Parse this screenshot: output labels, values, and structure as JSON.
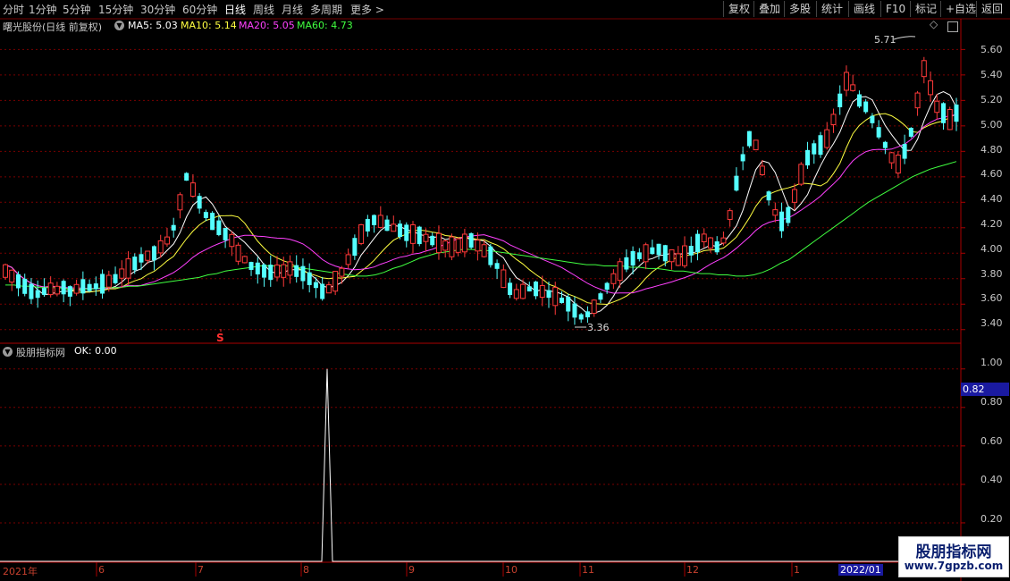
{
  "toolbar": {
    "tabs": [
      "分时",
      "1分钟",
      "5分钟",
      "15分钟",
      "30分钟",
      "60分钟",
      "日线",
      "周线",
      "月线",
      "多周期",
      "更多 >"
    ],
    "active_tab": "日线",
    "right_buttons": [
      "复权",
      "叠加",
      "多股",
      "统计",
      "画线",
      "F10",
      "标记",
      "+自选",
      "返回"
    ]
  },
  "chart": {
    "stock_title": "曙光股份(日线 前复权)",
    "ma5_label": "MA5: 5.03",
    "ma10_label": "MA10: 5.14",
    "ma20_label": "MA20: 5.05",
    "ma60_label": "MA60: 4.73",
    "high_marker": "5.71",
    "low_marker": "3.36",
    "signal_marker": "S",
    "price_axis": [
      "5.60",
      "5.40",
      "5.20",
      "5.00",
      "4.80",
      "4.60",
      "4.40",
      "4.20",
      "4.00",
      "3.80",
      "3.60",
      "3.40"
    ]
  },
  "indicator": {
    "title": "股朋指标网",
    "ok_label": "OK: 0.00",
    "axis": [
      "1.00",
      "0.80",
      "0.60",
      "0.40",
      "0.20"
    ],
    "current_value": "0.82"
  },
  "date_axis": [
    "2021年",
    "6",
    "7",
    "8",
    "9",
    "10",
    "11",
    "12",
    "1",
    "2022/01"
  ],
  "watermark": {
    "name": "股朋指标网",
    "url": "www.7gpzb.com"
  },
  "colors": {
    "up": "#ff3a3a",
    "down": "#54ffff",
    "ma5": "#ffffff",
    "ma10": "#ffff40",
    "ma20": "#ff40ff",
    "ma60": "#40ff40",
    "grid": "#7a0000",
    "date_highlight": "#1a1aa0"
  },
  "chart_data": {
    "type": "candlestick",
    "price_range": [
      3.3,
      5.75
    ],
    "indicator_range": [
      0,
      1.05
    ],
    "ma5_close": [
      3.86,
      3.82,
      3.78,
      3.74,
      3.7,
      3.68,
      3.7,
      3.72,
      3.71,
      3.73,
      3.7,
      3.72,
      3.74,
      3.73,
      3.74,
      3.76,
      3.78,
      3.8,
      3.84,
      3.88,
      3.92,
      3.96,
      3.98,
      4.0,
      4.05,
      4.1,
      4.2,
      4.4,
      4.6,
      4.5,
      4.4,
      4.3,
      4.25,
      4.2,
      4.15,
      4.1,
      4.0,
      3.95,
      3.9,
      3.88,
      3.86,
      3.85,
      3.86,
      3.86,
      3.88,
      3.86,
      3.84,
      3.8,
      3.75,
      3.7,
      3.72,
      3.78,
      3.85,
      3.95,
      4.05,
      4.15,
      4.22,
      4.26,
      4.25,
      4.22,
      4.2,
      4.18,
      4.16,
      4.15,
      4.14,
      4.12,
      4.1,
      4.08,
      4.06,
      4.05,
      4.06,
      4.08,
      4.1,
      4.06,
      4.02,
      3.98,
      3.9,
      3.8,
      3.72,
      3.68,
      3.7,
      3.72,
      3.72,
      3.7,
      3.68,
      3.66,
      3.63,
      3.6,
      3.55,
      3.5,
      3.52,
      3.58,
      3.66,
      3.74,
      3.8,
      3.86,
      3.92,
      3.96,
      3.98,
      4.0,
      4.02,
      4.03,
      4.0,
      3.98,
      3.95,
      3.98,
      4.02,
      4.08,
      4.12,
      4.08,
      4.05,
      4.1,
      4.3,
      4.55,
      4.75,
      4.9,
      4.85,
      4.65,
      4.45,
      4.32,
      4.25,
      4.3,
      4.45,
      4.62,
      4.75,
      4.82,
      4.85,
      4.9,
      5.05,
      5.2,
      5.35,
      5.3,
      5.2,
      5.15,
      5.05,
      4.95,
      4.85,
      4.75,
      4.7,
      4.8,
      4.95,
      5.2,
      5.45,
      5.3,
      5.15,
      5.1,
      5.05,
      5.1
    ],
    "ma60_close": [
      3.75,
      3.75,
      3.74,
      3.74,
      3.73,
      3.73,
      3.73,
      3.72,
      3.72,
      3.72,
      3.72,
      3.73,
      3.73,
      3.73,
      3.74,
      3.74,
      3.75,
      3.76,
      3.77,
      3.78,
      3.79,
      3.8,
      3.81,
      3.83,
      3.84,
      3.86,
      3.87,
      3.88,
      3.89,
      3.9,
      3.9,
      3.9,
      3.9,
      3.89,
      3.88,
      3.87,
      3.86,
      3.85,
      3.84,
      3.83,
      3.82,
      3.82,
      3.83,
      3.85,
      3.88,
      3.9,
      3.93,
      3.96,
      3.98,
      4.0,
      4.01,
      4.02,
      4.03,
      4.03,
      4.02,
      4.02,
      4.01,
      4.0,
      3.99,
      3.98,
      3.97,
      3.96,
      3.95,
      3.94,
      3.93,
      3.92,
      3.91,
      3.91,
      3.9,
      3.9,
      3.9,
      3.89,
      3.89,
      3.88,
      3.88,
      3.87,
      3.86,
      3.86,
      3.85,
      3.84,
      3.84,
      3.83,
      3.83,
      3.82,
      3.82,
      3.83,
      3.85,
      3.88,
      3.92,
      3.95,
      4.0,
      4.05,
      4.1,
      4.15,
      4.2,
      4.25,
      4.3,
      4.35,
      4.4,
      4.44,
      4.48,
      4.52,
      4.56,
      4.6,
      4.63,
      4.66,
      4.68,
      4.7,
      4.72
    ]
  }
}
